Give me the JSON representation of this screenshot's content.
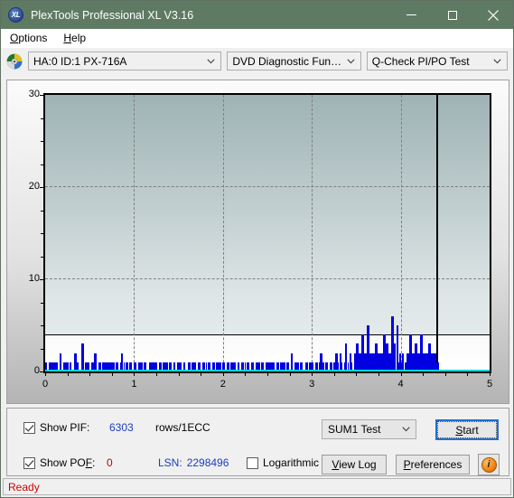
{
  "window": {
    "title": "PlexTools Professional XL V3.16",
    "app_icon": "xl-logo-icon",
    "minimize_label": "minimize-icon",
    "maximize_label": "maximize-icon",
    "close_label": "close-icon"
  },
  "menu": {
    "items": [
      {
        "label": "Options",
        "accel": "O"
      },
      {
        "label": "Help",
        "accel": "H"
      }
    ]
  },
  "toolbar": {
    "disc_icon": "disc-icon",
    "drive_select": "HA:0 ID:1  PX-716A",
    "function_select": "DVD Diagnostic Functions",
    "test_select": "Q-Check PI/PO Test"
  },
  "controls": {
    "show_pif_label": "Show PIF:",
    "show_pif_checked": true,
    "pif_value": "6303",
    "pif_units": "rows/1ECC",
    "show_pof_label": "Show POF:",
    "show_pof_checked": true,
    "pof_value": "0",
    "lsn_label": "LSN:",
    "lsn_value": "2298496",
    "logarithmic_label": "Logarithmic",
    "logarithmic_checked": false,
    "sum_test_select": "SUM1 Test",
    "start_label": "Start",
    "view_log_label": "View Log",
    "preferences_label": "Preferences",
    "info_label": "i"
  },
  "status": {
    "text": "Ready"
  },
  "colors": {
    "title_bar": "#5f7a62",
    "pif_bar": "#0000e0",
    "pof_line": "#00d8d8",
    "pif_value": "#1a3dc4",
    "pof_value": "#cc0000",
    "status_text": "#d00000",
    "focus_border": "#1f6fd0"
  },
  "chart_data": {
    "type": "bar",
    "title": "Q-Check PI/PO Test",
    "xlabel": "",
    "ylabel": "",
    "xlim": [
      0,
      5
    ],
    "ylim": [
      0,
      30
    ],
    "xticks": [
      0,
      1,
      2,
      3,
      4,
      5
    ],
    "yticks": [
      0,
      10,
      20,
      30
    ],
    "grid": true,
    "threshold": 4,
    "data_end_x": 4.4,
    "series": [
      {
        "name": "PIF",
        "color": "#0000e0",
        "max": 6303,
        "units": "rows/1ECC"
      },
      {
        "name": "POF",
        "color": "#00d8d8",
        "max": 0,
        "units": "rows/1ECC"
      }
    ],
    "points": [
      [
        0.06,
        1
      ],
      [
        0.1,
        1
      ],
      [
        0.16,
        2
      ],
      [
        0.22,
        1
      ],
      [
        0.27,
        1
      ],
      [
        0.33,
        2
      ],
      [
        0.35,
        1
      ],
      [
        0.41,
        3
      ],
      [
        0.46,
        1
      ],
      [
        0.52,
        1
      ],
      [
        0.55,
        2
      ],
      [
        0.6,
        1
      ],
      [
        0.66,
        1
      ],
      [
        0.69,
        1
      ],
      [
        0.74,
        1
      ],
      [
        0.79,
        1
      ],
      [
        0.85,
        2
      ],
      [
        0.9,
        1
      ],
      [
        0.95,
        1
      ],
      [
        1.0,
        1
      ],
      [
        1.06,
        1
      ],
      [
        1.11,
        1
      ],
      [
        1.17,
        1
      ],
      [
        1.22,
        1
      ],
      [
        1.28,
        1
      ],
      [
        1.33,
        1
      ],
      [
        1.39,
        1
      ],
      [
        1.44,
        1
      ],
      [
        1.5,
        1
      ],
      [
        1.55,
        1
      ],
      [
        1.61,
        1
      ],
      [
        1.66,
        1
      ],
      [
        1.72,
        1
      ],
      [
        1.77,
        1
      ],
      [
        1.83,
        1
      ],
      [
        1.88,
        1
      ],
      [
        1.94,
        1
      ],
      [
        1.99,
        1
      ],
      [
        2.05,
        1
      ],
      [
        2.1,
        1
      ],
      [
        2.16,
        1
      ],
      [
        2.21,
        1
      ],
      [
        2.27,
        1
      ],
      [
        2.32,
        1
      ],
      [
        2.38,
        1
      ],
      [
        2.43,
        1
      ],
      [
        2.49,
        1
      ],
      [
        2.54,
        1
      ],
      [
        2.6,
        1
      ],
      [
        2.65,
        1
      ],
      [
        2.71,
        1
      ],
      [
        2.76,
        2
      ],
      [
        2.82,
        1
      ],
      [
        2.87,
        1
      ],
      [
        2.93,
        1
      ],
      [
        2.98,
        1
      ],
      [
        3.04,
        1
      ],
      [
        3.09,
        2
      ],
      [
        3.15,
        1
      ],
      [
        3.2,
        1
      ],
      [
        3.26,
        2
      ],
      [
        3.31,
        2
      ],
      [
        3.37,
        3
      ],
      [
        3.42,
        2
      ],
      [
        3.48,
        2
      ],
      [
        3.5,
        3
      ],
      [
        3.53,
        2
      ],
      [
        3.56,
        4
      ],
      [
        3.59,
        2
      ],
      [
        3.62,
        5
      ],
      [
        3.65,
        2
      ],
      [
        3.68,
        2
      ],
      [
        3.71,
        3
      ],
      [
        3.74,
        2
      ],
      [
        3.77,
        2
      ],
      [
        3.8,
        4
      ],
      [
        3.83,
        3
      ],
      [
        3.86,
        2
      ],
      [
        3.89,
        6
      ],
      [
        3.92,
        3
      ],
      [
        3.95,
        5
      ],
      [
        3.98,
        2
      ],
      [
        4.01,
        2
      ],
      [
        4.04,
        1
      ],
      [
        4.07,
        2
      ],
      [
        4.1,
        4
      ],
      [
        4.13,
        2
      ],
      [
        4.16,
        3
      ],
      [
        4.19,
        2
      ],
      [
        4.22,
        4
      ],
      [
        4.25,
        2
      ],
      [
        4.28,
        2
      ],
      [
        4.31,
        3
      ],
      [
        4.34,
        2
      ],
      [
        4.37,
        2
      ],
      [
        4.4,
        1
      ]
    ]
  }
}
